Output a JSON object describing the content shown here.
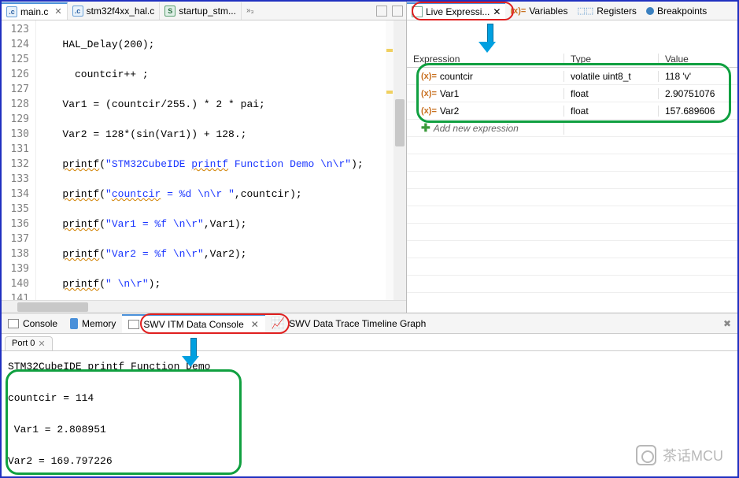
{
  "editor_tabs": [
    {
      "label": "main.c",
      "kind": "c",
      "active": true,
      "closeable": true
    },
    {
      "label": "stm32f4xx_hal.c",
      "kind": "c",
      "active": false,
      "closeable": false
    },
    {
      "label": "startup_stm...",
      "kind": "s",
      "active": false,
      "closeable": false
    }
  ],
  "editor_overflow_indicator": "»₃",
  "code": {
    "first_line": 123,
    "lines": [
      "",
      "   HAL_Delay(200);",
      "",
      "     countcir++ ;",
      "",
      "   Var1 = (countcir/255.) * 2 * pai;",
      "",
      "   Var2 = 128*(sin(Var1)) + 128.;",
      "",
      "   printf(\"STM32CubeIDE printf Function Demo \\n\\r\");",
      "",
      "   printf(\"countcir = %d \\n\\r \",countcir);",
      "",
      "   printf(\"Var1 = %f \\n\\r\",Var1);",
      "",
      "   printf(\"Var2 = %f \\n\\r\",Var2);",
      "",
      "   printf(\" \\n\\r\");",
      ""
    ]
  },
  "right_tabs": [
    {
      "label": "Live Expressi...",
      "icon": "live",
      "active": true,
      "closeable": true
    },
    {
      "label": "Variables",
      "icon": "var",
      "active": false
    },
    {
      "label": "Registers",
      "icon": "reg",
      "active": false
    },
    {
      "label": "Breakpoints",
      "icon": "bp",
      "active": false
    }
  ],
  "expr_headers": {
    "e": "Expression",
    "t": "Type",
    "v": "Value"
  },
  "expressions": [
    {
      "name": "countcir",
      "type": "volatile uint8_t",
      "value": "118 'v'"
    },
    {
      "name": "Var1",
      "type": "float",
      "value": "2.90751076"
    },
    {
      "name": "Var2",
      "type": "float",
      "value": "157.689606"
    }
  ],
  "add_expr_label": "Add new expression",
  "bottom_tabs": [
    {
      "label": "Console",
      "icon": "console",
      "active": false
    },
    {
      "label": "Memory",
      "icon": "mem",
      "active": false
    },
    {
      "label": "SWV ITM Data Console",
      "icon": "swv",
      "active": true,
      "closeable": true
    },
    {
      "label": "SWV Data Trace Timeline Graph",
      "icon": "trace",
      "active": false
    }
  ],
  "port_tab": "Port 0",
  "console_output": "STM32CubeIDE printf Function Demo\n\ncountcir = 114\n\n Var1 = 2.808951\n\nVar2 = 169.797226",
  "watermark": "茶话MCU"
}
